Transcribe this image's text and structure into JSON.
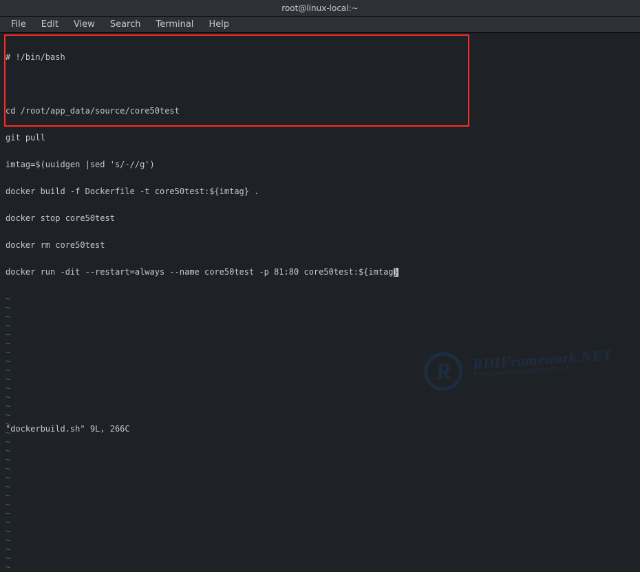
{
  "titlebar": {
    "title": "root@linux-local:~"
  },
  "menu": {
    "items": [
      "File",
      "Edit",
      "View",
      "Search",
      "Terminal",
      "Help"
    ]
  },
  "editor": {
    "lines": [
      "# !/bin/bash",
      "",
      "cd /root/app_data/source/core50test",
      "git pull",
      "imtag=$(uuidgen |sed 's/-//g')",
      "docker build -f Dockerfile -t core50test:${imtag} .",
      "docker stop core50test",
      "docker rm core50test",
      "docker run -dit --restart=always --name core50test -p 81:80 core50test:${imtag"
    ],
    "cursor_char": "}",
    "tilde_count": 31,
    "status": "\"dockerbuild.sh\" 9L, 266C"
  },
  "watermark": {
    "logo_letter": "R",
    "title": "RDIFramework.NET",
    "url": "http://www.rdiframework.net"
  }
}
